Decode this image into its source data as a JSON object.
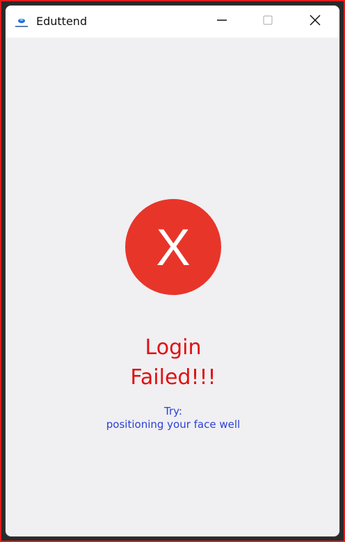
{
  "window": {
    "title": "Eduttend",
    "app_icon": "eduttend-logo-icon",
    "controls": {
      "minimize_icon": "minimize-icon",
      "maximize_icon": "maximize-icon",
      "close_icon": "close-icon"
    }
  },
  "status": {
    "icon_glyph": "X",
    "icon_name": "error-x-icon",
    "icon_color": "#e8352a",
    "headline_line1": "Login",
    "headline_line2": "Failed!!!",
    "headline_color": "#e01010"
  },
  "hint": {
    "label": "Try:",
    "message": "positioning your face well",
    "color": "#2b40d8"
  }
}
